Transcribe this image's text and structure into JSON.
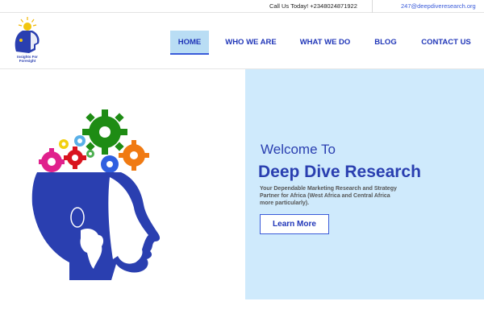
{
  "topbar": {
    "call_text": "Call Us Today! +2348024871922",
    "email": "247@deepdiveresearch.org"
  },
  "logo": {
    "tagline_line1": "Insights For",
    "tagline_line2": "Foresight"
  },
  "nav": {
    "items": [
      {
        "label": "HOME",
        "active": true
      },
      {
        "label": "WHO WE ARE",
        "active": false
      },
      {
        "label": "WHAT WE DO",
        "active": false
      },
      {
        "label": "BLOG",
        "active": false
      },
      {
        "label": "CONTACT US",
        "active": false
      }
    ]
  },
  "hero": {
    "welcome": "Welcome To",
    "brand": "Deep Dive Research",
    "tagline": "Your Dependable Marketing Research and Strategy Partner for Africa (West Africa and Central Africa more particularly).",
    "cta_label": "Learn More"
  },
  "colors": {
    "brand_blue": "#2a3fb0",
    "hero_bg": "#cfeafc",
    "nav_active_bg": "#b9ddf4"
  }
}
